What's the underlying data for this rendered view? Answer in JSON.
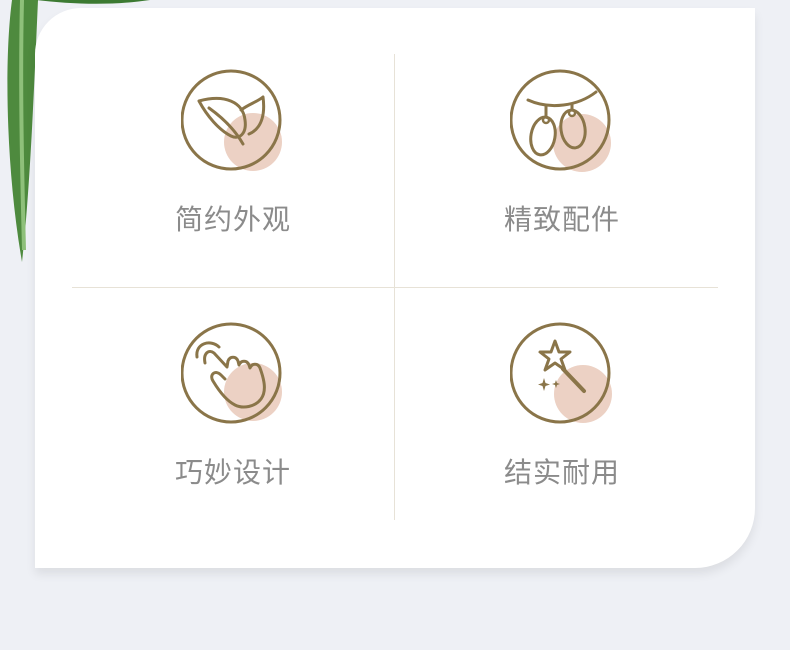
{
  "features": [
    {
      "label": "简约外观",
      "icon": "leaf-icon"
    },
    {
      "label": "精致配件",
      "icon": "earrings-icon"
    },
    {
      "label": "巧妙设计",
      "icon": "pointing-hand-icon"
    },
    {
      "label": "结实耐用",
      "icon": "magic-wand-icon"
    }
  ],
  "colors": {
    "background": "#eef0f5",
    "card": "#ffffff",
    "icon_stroke": "#8a7549",
    "icon_accent": "#ecd1c4",
    "label": "#8b8b8b",
    "divider": "#e7e2d7"
  }
}
